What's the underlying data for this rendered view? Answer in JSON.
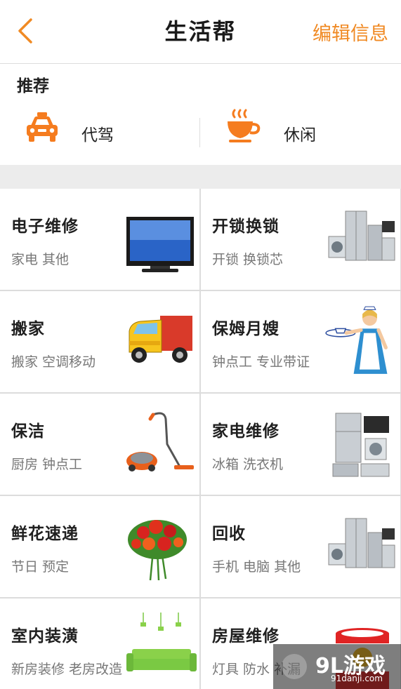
{
  "header": {
    "title": "生活帮",
    "edit_label": "编辑信息",
    "back_icon": "chevron-left-icon"
  },
  "recommend": {
    "title": "推荐",
    "items": [
      {
        "label": "代驾",
        "icon": "taxi-icon"
      },
      {
        "label": "休闲",
        "icon": "hot-cup-icon"
      }
    ]
  },
  "services": [
    {
      "title": "电子维修",
      "sub": "家电 其他",
      "image": "tv-image"
    },
    {
      "title": "开锁换锁",
      "sub": "开锁 换锁芯",
      "image": "appliances-image"
    },
    {
      "title": "搬家",
      "sub": "搬家 空调移动",
      "image": "truck-image"
    },
    {
      "title": "保姆月嫂",
      "sub": "钟点工 专业带证",
      "image": "maid-image"
    },
    {
      "title": "保洁",
      "sub": "厨房 钟点工",
      "image": "vacuum-image"
    },
    {
      "title": "家电维修",
      "sub": "冰箱 洗衣机",
      "image": "appliances-image"
    },
    {
      "title": "鲜花速递",
      "sub": "节日 预定",
      "image": "flower-bouquet-image"
    },
    {
      "title": "回收",
      "sub": "手机 电脑 其他",
      "image": "appliances-image"
    },
    {
      "title": "室内装潢",
      "sub": "新房装修 老房改造",
      "image": "living-room-image"
    },
    {
      "title": "房屋维修",
      "sub": "灯具 防水 补漏",
      "image": "paint-bucket-image"
    }
  ],
  "watermark": {
    "logo_text": "9L游戏",
    "domain": "91danji.com"
  },
  "colors": {
    "accent": "#f08a24",
    "page_bg": "#f4f4f4",
    "divider": "#dcdcdc"
  }
}
